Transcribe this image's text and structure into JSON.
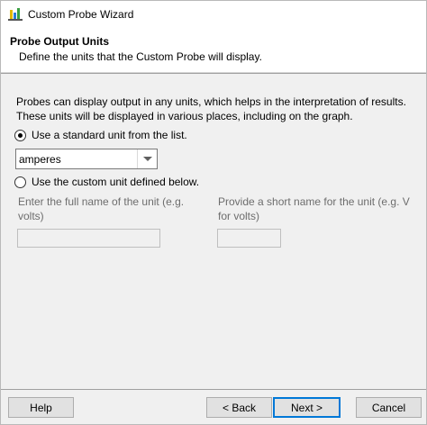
{
  "window": {
    "title": "Custom Probe Wizard",
    "icon": "probe-wizard-icon"
  },
  "header": {
    "title": "Probe Output Units",
    "description": "Define the units that the Custom Probe will display."
  },
  "intro": {
    "line1": "Probes can display output in any units, which helps in the interpretation of results.",
    "line2": "These units will be displayed in various places, including on the graph."
  },
  "standard_unit": {
    "label": "Use a standard unit from the list.",
    "selected": true,
    "value": "amperes"
  },
  "custom_unit": {
    "label": "Use the custom unit defined below.",
    "selected": false,
    "full_name_hint": "Enter the full name of the unit (e.g. volts)",
    "short_name_hint_line1": "Provide a short name for the unit (e.g. V",
    "short_name_hint_line2": "for volts)",
    "full_name_value": "",
    "short_name_value": ""
  },
  "buttons": {
    "help": "Help",
    "back": "< Back",
    "next": "Next >",
    "cancel": "Cancel"
  },
  "colors": {
    "accent": "#0078d7",
    "panel": "#f0f0f0",
    "hint_text": "#6d6d6d"
  }
}
